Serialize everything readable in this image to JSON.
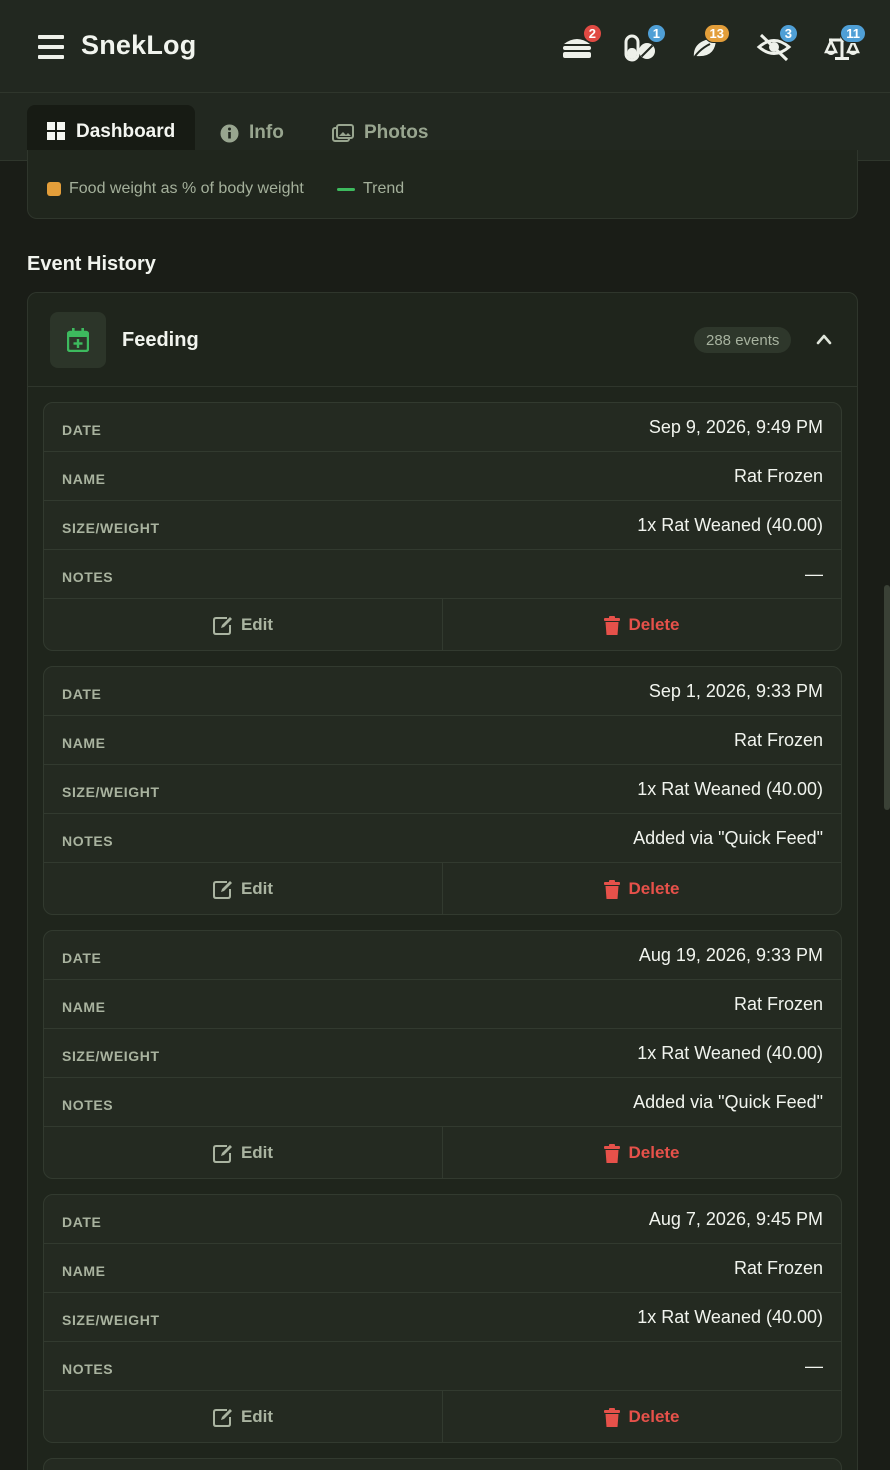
{
  "app": {
    "title": "SnekLog"
  },
  "header_icons": [
    {
      "name": "food-stack-icon",
      "badge": "2",
      "badge_color": "#e04a43"
    },
    {
      "name": "pills-icon",
      "badge": "1",
      "badge_color": "#4f9fd6"
    },
    {
      "name": "leaf-icon",
      "badge": "13",
      "badge_color": "#e39e3a"
    },
    {
      "name": "eye-slash-icon",
      "badge": "3",
      "badge_color": "#4f9fd6"
    },
    {
      "name": "scale-icon",
      "badge": "11",
      "badge_color": "#4f9fd6"
    }
  ],
  "tabs": [
    {
      "label": "Dashboard",
      "icon": "grid-icon",
      "active": true
    },
    {
      "label": "Info",
      "icon": "info-circle-icon",
      "active": false
    },
    {
      "label": "Photos",
      "icon": "images-icon",
      "active": false
    }
  ],
  "chart_legend": [
    {
      "label": "Food weight as % of body weight",
      "color": "#e39e3a"
    },
    {
      "label": "Trend",
      "color": "#3dba5e"
    }
  ],
  "section": {
    "title": "Event History"
  },
  "group": {
    "title": "Feeding",
    "count": "288 events",
    "icon": "calendar-plus-icon"
  },
  "field_labels": {
    "date": "DATE",
    "name": "NAME",
    "size": "SIZE/WEIGHT",
    "notes": "NOTES"
  },
  "actions": {
    "edit": "Edit",
    "delete": "Delete"
  },
  "events": [
    {
      "date": "Sep 9, 2026, 9:49 PM",
      "name": "Rat Frozen",
      "size": "1x Rat Weaned (40.00)",
      "notes": "—"
    },
    {
      "date": "Sep 1, 2026, 9:33 PM",
      "name": "Rat Frozen",
      "size": "1x Rat Weaned (40.00)",
      "notes": "Added via \"Quick Feed\""
    },
    {
      "date": "Aug 19, 2026, 9:33 PM",
      "name": "Rat Frozen",
      "size": "1x Rat Weaned (40.00)",
      "notes": "Added via \"Quick Feed\""
    },
    {
      "date": "Aug 7, 2026, 9:45 PM",
      "name": "Rat Frozen",
      "size": "1x Rat Weaned (40.00)",
      "notes": "—"
    }
  ],
  "colors": {
    "accent": "#3dba5e",
    "danger": "#e6514a",
    "background": "#1a1d17",
    "surface": "#242a21"
  }
}
